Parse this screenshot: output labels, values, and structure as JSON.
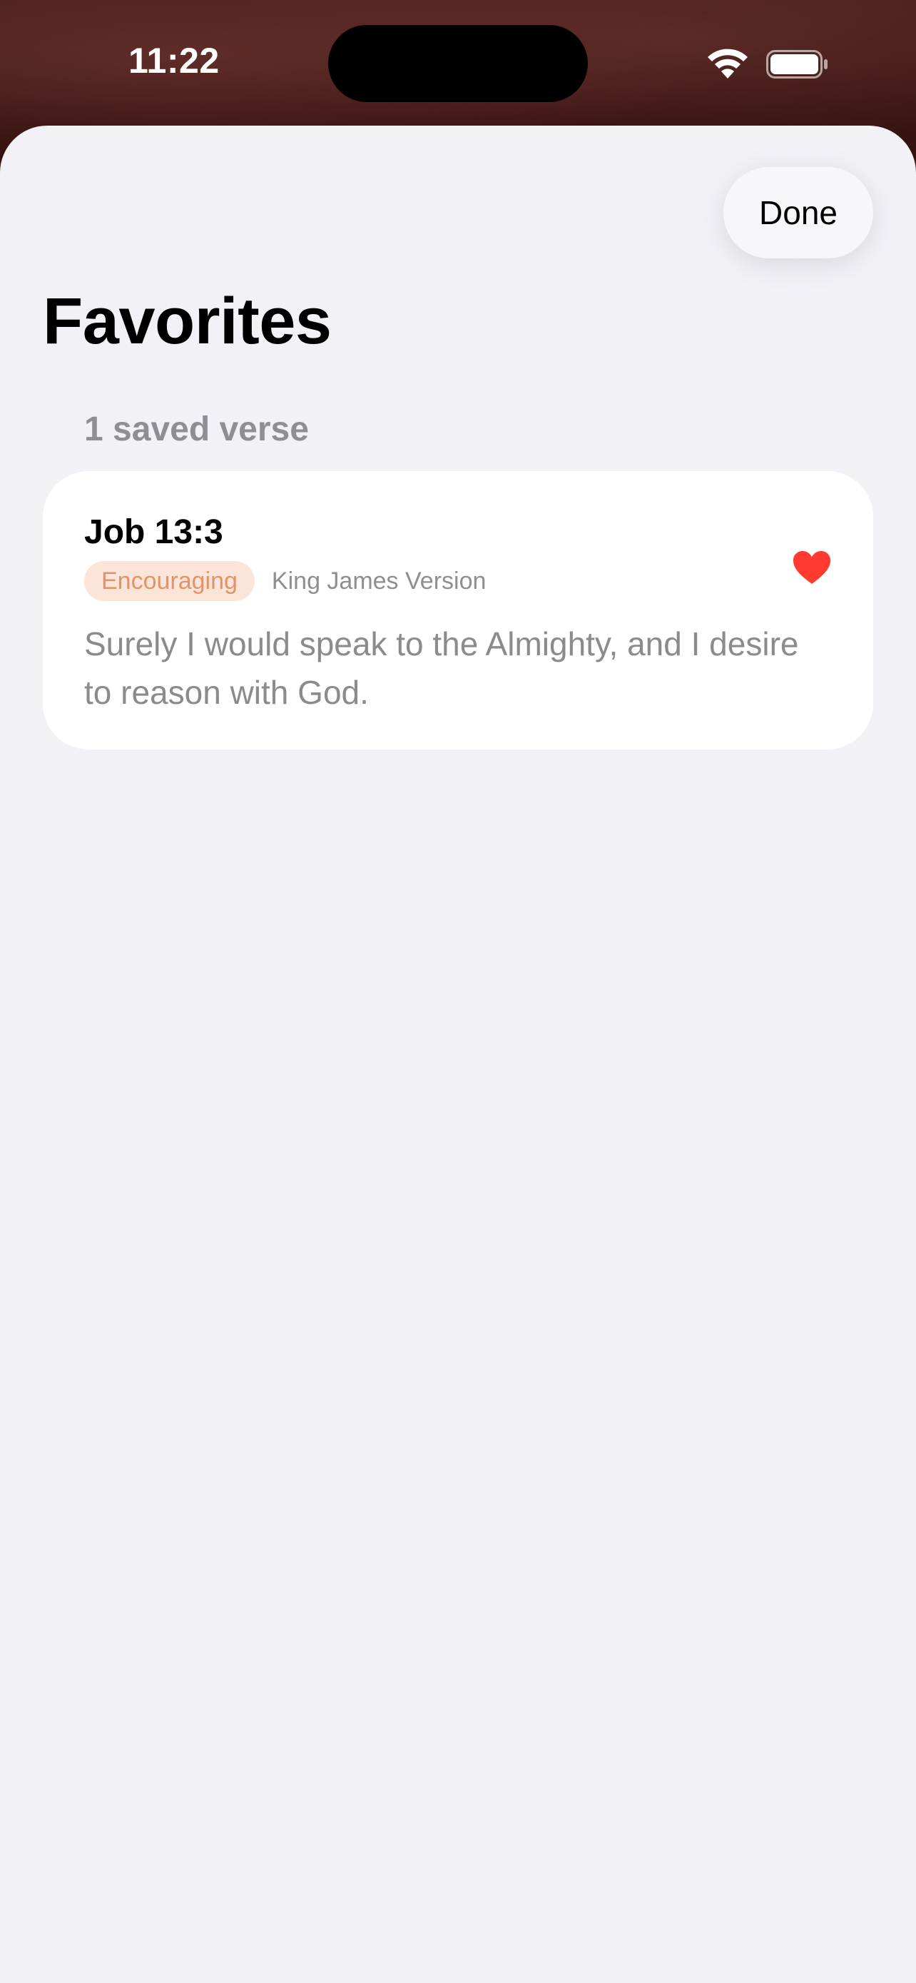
{
  "status_bar": {
    "time": "11:22"
  },
  "sheet": {
    "done_label": "Done",
    "title": "Favorites",
    "count_label": "1 saved verse"
  },
  "favorites": [
    {
      "reference": "Job 13:3",
      "mood": "Encouraging",
      "translation": "King James Version",
      "text": "Surely I would speak to the Almighty, and I desire to reason with God.",
      "favorited": true
    }
  ],
  "colors": {
    "sheet_background": "#f2f1f6",
    "card_background": "#ffffff",
    "badge_background": "#fbe5d8",
    "badge_text": "#e3936a",
    "heart": "#ff3b30",
    "secondary_text": "#8e8e93"
  },
  "icons": {
    "favorite": "heart-icon",
    "wifi": "wifi-icon",
    "battery": "battery-icon"
  }
}
